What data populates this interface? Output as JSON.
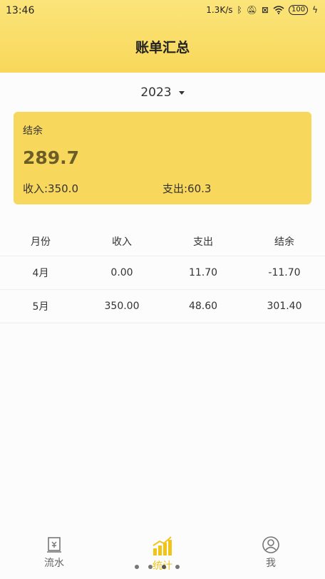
{
  "status_bar": {
    "time": "13:46",
    "speed": "1.3K/s",
    "battery": "100"
  },
  "header": {
    "title": "账单汇总"
  },
  "year_selector": {
    "value": "2023"
  },
  "summary": {
    "label": "结余",
    "balance": "289.7",
    "income": "收入:350.0",
    "expense": "支出:60.3"
  },
  "table": {
    "headers": [
      "月份",
      "收入",
      "支出",
      "结余"
    ],
    "rows": [
      [
        "4月",
        "0.00",
        "11.70",
        "-11.70"
      ],
      [
        "5月",
        "350.00",
        "48.60",
        "301.40"
      ]
    ]
  },
  "tabbar": {
    "items": [
      {
        "label": "流水",
        "icon": "ledger-icon"
      },
      {
        "label": "统计",
        "icon": "bar-chart-icon",
        "active": true
      },
      {
        "label": "我",
        "icon": "user-icon"
      }
    ]
  },
  "colors": {
    "accent": "#f8d85c",
    "active_tab": "#f0c419"
  }
}
